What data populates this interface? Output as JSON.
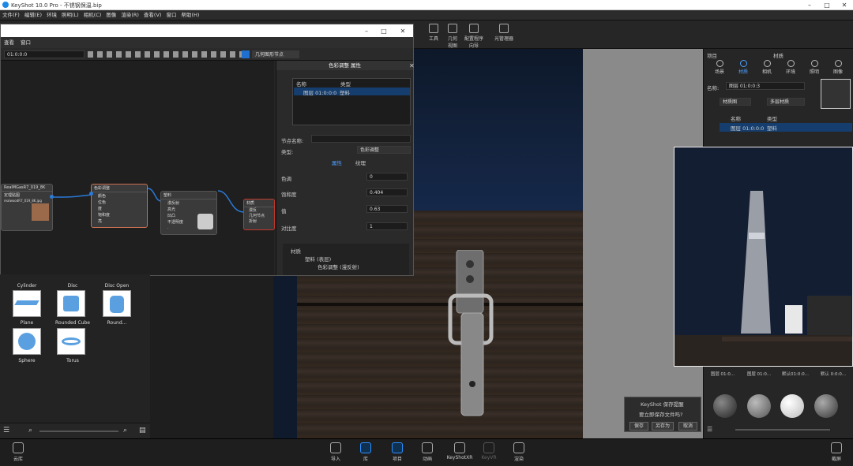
{
  "app": {
    "title": "KeyShot 10.0 Pro - 不锈钢保温.bip"
  },
  "menu": [
    "文件(F)",
    "编辑(E)",
    "环境",
    "照明(L)",
    "相机(C)",
    "图像",
    "渲染(R)",
    "查看(V)",
    "窗口",
    "帮助(H)"
  ],
  "toolbar": [
    {
      "label": "工具",
      "icon": "tools-icon"
    },
    {
      "label": "几何\n视图",
      "icon": "geometry-view-icon"
    },
    {
      "label": "配置程序\n向导",
      "icon": "configurator-icon"
    },
    {
      "label": "光管理器",
      "icon": "light-manager-icon"
    }
  ],
  "node_window": {
    "menu": [
      "查看",
      "窗口"
    ],
    "field_value": "01:0:0:0",
    "geo_button": "几何图形节点",
    "nodes": [
      {
        "title": "RealMGasR7_019_8K",
        "sub": "定理贴图",
        "sub2": "realwoodR7_019_8K.jpg"
      },
      {
        "title": "色彩调整",
        "ports": [
          "颜色",
          "位色",
          "度",
          "饱和度",
          "亮"
        ]
      },
      {
        "title": "塑料",
        "ports": [
          "漫反射",
          "高光",
          "凹凸",
          "不透明度",
          "·"
        ]
      },
      {
        "title": "材质",
        "ports": [
          "漫反",
          "几何节点",
          "折射"
        ]
      }
    ]
  },
  "props": {
    "title": "色彩调整 属性",
    "col_name": "名称",
    "col_type": "类型",
    "row": {
      "name": "图层 01:0:0:0",
      "type": "塑料"
    },
    "node_name_label": "节点名称:",
    "type_label": "类型:",
    "type_value": "色彩调整",
    "tab_props": "属性",
    "tab_tex": "纹理",
    "params": [
      {
        "label": "色调",
        "value": "0"
      },
      {
        "label": "饱和度",
        "value": "0.404"
      },
      {
        "label": "值",
        "value": "0.63"
      },
      {
        "label": "对比度",
        "value": "1"
      }
    ],
    "tree": [
      "材质",
      "塑料 (表层)",
      "色彩调整 (漫反射)"
    ]
  },
  "library": {
    "top_labels": [
      "Cylinder",
      "Disc",
      "Disc Open"
    ],
    "items": [
      {
        "label": "Plane"
      },
      {
        "label": "Rounded Cube"
      },
      {
        "label": "Round..."
      },
      {
        "label": "Sphere"
      },
      {
        "label": "Torus"
      }
    ]
  },
  "right_panel": {
    "title": "项目",
    "title2": "材质",
    "tabs": [
      "场景",
      "材质",
      "相机",
      "环境",
      "照明",
      "图像"
    ],
    "name_label": "名称:",
    "name_value": "图层 01:0:0:3",
    "btn_material_graph": "材质图",
    "btn_multi": "多层材质",
    "col_name": "名称",
    "col_type": "类型",
    "row": {
      "name": "图层 01:0:0:0",
      "type": "塑料"
    },
    "swatches": [
      "图层 01:0...",
      "图层 01:0...",
      "默认01:0:0...",
      "默认 0:0:0..."
    ]
  },
  "dialog": {
    "title": "KeyShot 保存提醒",
    "msg": "要立即保存文件吗?",
    "save": "保存",
    "save_as": "另存为",
    "cancel": "取消"
  },
  "bottom": {
    "cloud": "云库",
    "import": "导入",
    "library": "库",
    "project": "项目",
    "animation": "动画",
    "keyshotxr": "KeyShotXR",
    "keyvr": "KeyVR",
    "render": "渲染",
    "screenshot": "截屏"
  }
}
